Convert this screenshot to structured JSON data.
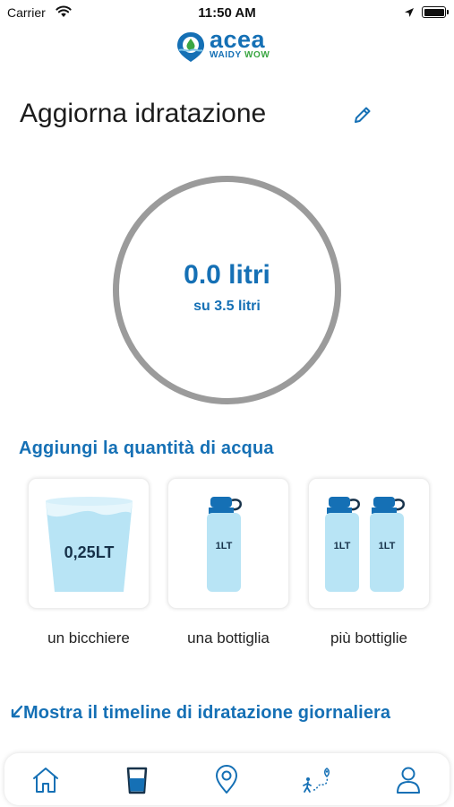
{
  "status_bar": {
    "carrier": "Carrier",
    "time": "11:50 AM"
  },
  "logo": {
    "word": "acea",
    "sub_left": "WAIDY",
    "sub_right": "WOW"
  },
  "header": {
    "title": "Aggiorna idratazione",
    "edit_icon": "pencil-icon"
  },
  "progress": {
    "current": "0.0 litri",
    "goal": "su 3.5 litri",
    "fraction": 0.0
  },
  "add_section": {
    "title": "Aggiungi la quantità di acqua",
    "options": [
      {
        "caption": "un bicchiere",
        "label": "0,25LT",
        "icon": "glass-icon"
      },
      {
        "caption": "una bottiglia",
        "label": "1LT",
        "icon": "bottle-icon"
      },
      {
        "caption": "più bottiglie",
        "labels": [
          "1LT",
          "1LT"
        ],
        "icon": "bottles-icon"
      }
    ]
  },
  "timeline_link": "Mostra il timeline di idratazione giornaliera",
  "tabbar": {
    "tabs": [
      {
        "icon": "home-icon",
        "active": false
      },
      {
        "icon": "water-glass-icon",
        "active": true
      },
      {
        "icon": "map-pin-icon",
        "active": false
      },
      {
        "icon": "walk-route-icon",
        "active": false
      },
      {
        "icon": "profile-icon",
        "active": false
      }
    ]
  },
  "colors": {
    "accent": "#1570b5",
    "water": "#b8e4f5",
    "ring": "#9b9b9b",
    "green": "#3aa642"
  }
}
